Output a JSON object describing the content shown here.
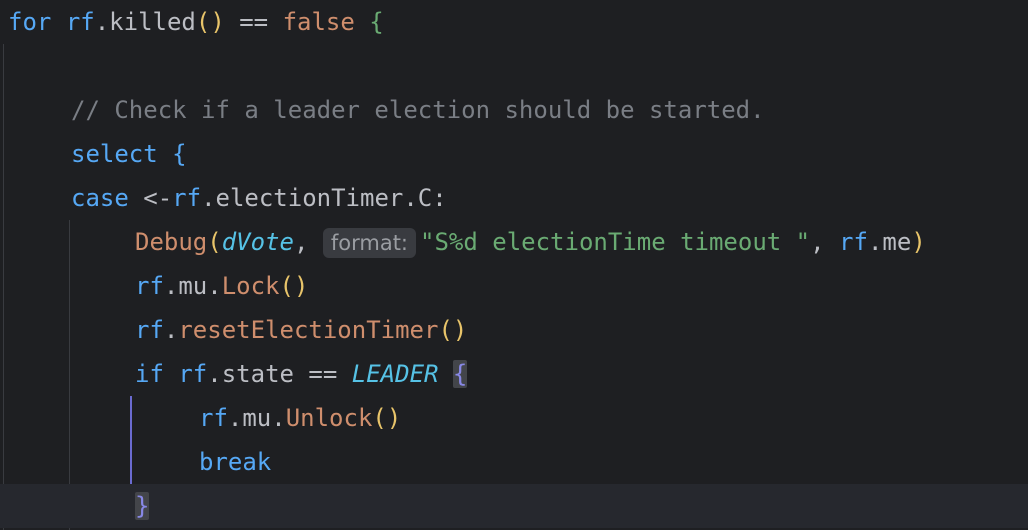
{
  "lines": {
    "l1": {
      "for": "for",
      "rf": "rf",
      "dot": ".",
      "killed": "killed",
      "parens": "()",
      "eq": " == ",
      "false": "false",
      "brace": "{"
    },
    "l3": {
      "comment": "// Check if a leader election should be started."
    },
    "l4": {
      "select": "select",
      "brace": "{"
    },
    "l5": {
      "case": "case",
      "arrow": " <-",
      "rf": "rf",
      "rest": ".electionTimer.C:"
    },
    "l6": {
      "debug": "Debug",
      "open": "(",
      "dvote": "dVote",
      "comma": ", ",
      "hint": "format:",
      "str": "\"S%d electionTime timeout \"",
      "comma2": ", ",
      "rf": "rf",
      "me": ".me",
      "close": ")"
    },
    "l7": {
      "rf": "rf",
      "mu": ".mu.",
      "lock": "Lock",
      "parens": "()"
    },
    "l8": {
      "rf": "rf",
      "dot": ".",
      "reset": "resetElectionTimer",
      "parens": "()"
    },
    "l9": {
      "if": "if",
      "rf": "rf",
      "state": ".state == ",
      "leader": "LEADER",
      "brace": "{"
    },
    "l10": {
      "rf": "rf",
      "mu": ".mu.",
      "unlock": "Unlock",
      "parens": "()"
    },
    "l11": {
      "break": "break"
    },
    "l12": {
      "brace": "}"
    }
  }
}
